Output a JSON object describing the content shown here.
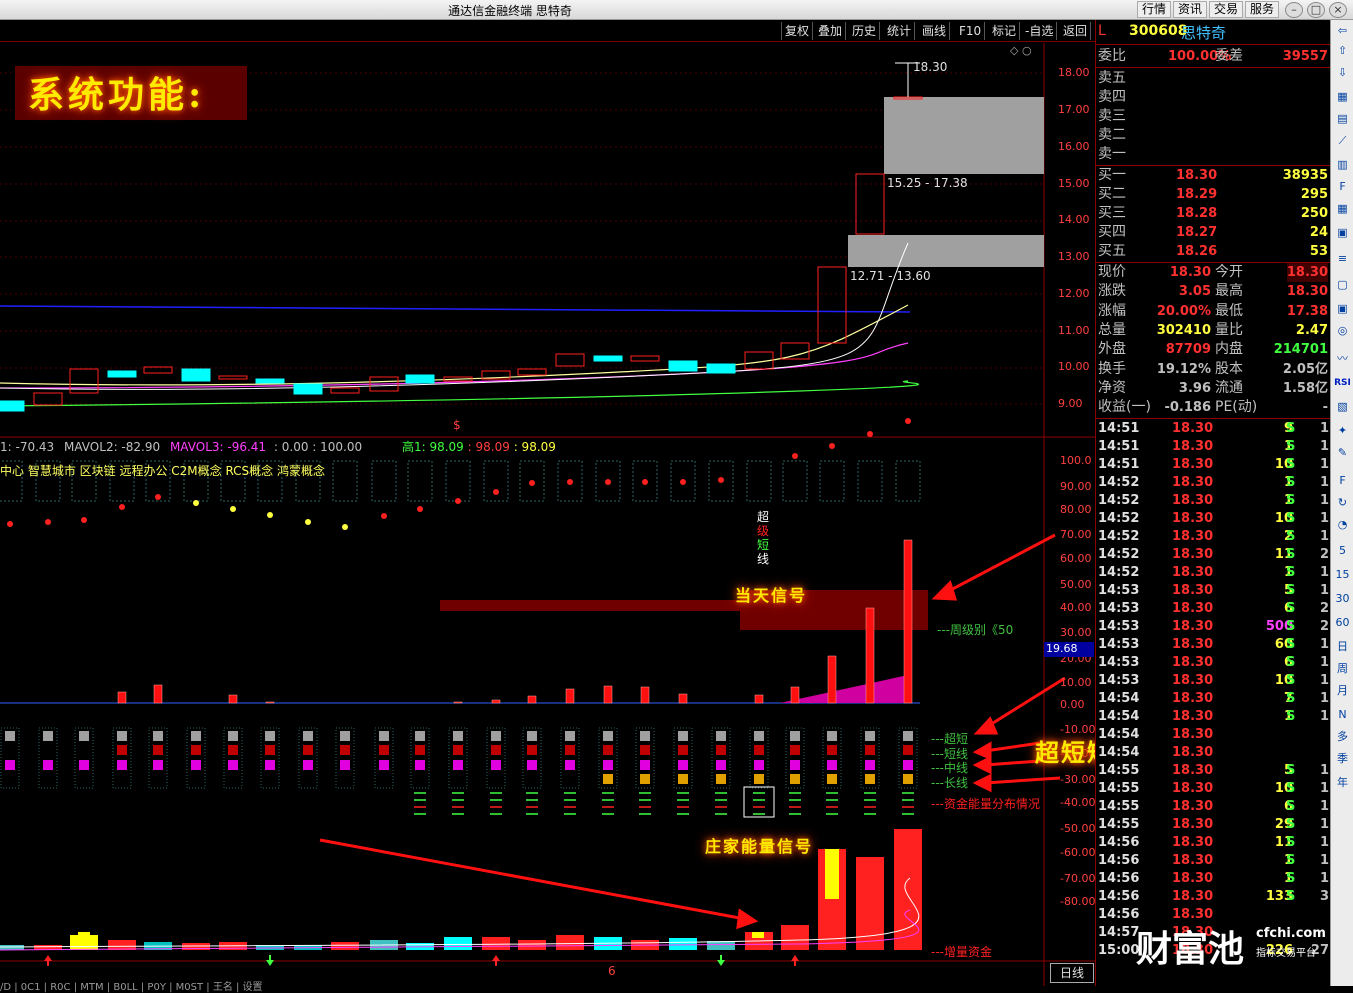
{
  "window": {
    "title": "通达信金融终端  思特奇"
  },
  "top_tabs": [
    "行情",
    "资讯",
    "交易",
    "服务"
  ],
  "toolbar": [
    "复权",
    "叠加",
    "历史",
    "统计",
    "画线",
    "F10",
    "标记",
    "-自选",
    "返回"
  ],
  "stock": {
    "code": "300608",
    "name": "思特奇",
    "marker": "L"
  },
  "price_axis": [
    "18.00",
    "17.00",
    "16.00",
    "15.00",
    "14.00",
    "13.00",
    "12.00",
    "11.00",
    "10.00",
    "9.00"
  ],
  "price_annotations": {
    "high": "18.30",
    "zone_upper": "15.25 - 17.38",
    "zone_lower": "12.71 - 13.60"
  },
  "mavol_line": {
    "v1": "1: -70.43",
    "v2": "MAVOL2: -82.90",
    "v3": "MAVOL3: -96.41",
    "v4": ": 0.00 : 100.00",
    "h_label": "高1: 98.09",
    "h2": ": 98.09",
    "h3": ": 98.09"
  },
  "concepts": "中心 智慧城市 区块链 远程办公 C2M概念 RCS概念 鸿蒙概念",
  "ind_axis": [
    "100.0",
    "90.00",
    "80.00",
    "70.00",
    "60.00",
    "50.00",
    "40.00",
    "30.00",
    "20.00",
    "10.00",
    "0.00",
    "-10.00",
    "-20.00",
    "-30.00",
    "-40.00",
    "-50.00",
    "-60.00",
    "-70.00",
    "-80.00"
  ],
  "ind_current": "19.68",
  "labels": {
    "weekly": "---周级别《50",
    "chaoduan": "---超短",
    "duanxian": "---短线",
    "zhongxian": "---中线",
    "changxian": "---长线",
    "zijin": "---资金能量分布情况",
    "zengliang": "---增量资金",
    "chaoji_1": "超",
    "chaoji_2": "级",
    "chaoji_3": "短",
    "chaoji_4": "线",
    "dollar": "$",
    "day_marker": "6",
    "rixian": "日线"
  },
  "annotations": {
    "system": "系统功能:",
    "today": "当天信号",
    "conditions": "超短短线中线长线条件",
    "zhuangjia": "庄家能量信号"
  },
  "order_book": {
    "weibi_label": "委比",
    "weibi": "100.00%",
    "weicha_label": "委差",
    "weicha": "39557",
    "sells": [
      "卖五",
      "卖四",
      "卖三",
      "卖二",
      "卖一"
    ],
    "buys": [
      {
        "label": "买一",
        "price": "18.30",
        "vol": "38935"
      },
      {
        "label": "买二",
        "price": "18.29",
        "vol": "295"
      },
      {
        "label": "买三",
        "price": "18.28",
        "vol": "250"
      },
      {
        "label": "买四",
        "price": "18.27",
        "vol": "24"
      },
      {
        "label": "买五",
        "price": "18.26",
        "vol": "53"
      }
    ]
  },
  "stats": [
    {
      "l1": "现价",
      "v1": "18.30",
      "l2": "今开",
      "v2": "18.30"
    },
    {
      "l1": "涨跌",
      "v1": "3.05",
      "l2": "最高",
      "v2": "18.30"
    },
    {
      "l1": "涨幅",
      "v1": "20.00%",
      "l2": "最低",
      "v2": "17.38"
    },
    {
      "l1": "总量",
      "v1": "302410",
      "l2": "量比",
      "v2": "2.47"
    },
    {
      "l1": "外盘",
      "v1": "87709",
      "l2": "内盘",
      "v2": "214701"
    },
    {
      "l1": "换手",
      "v1": "19.12%",
      "l2": "股本",
      "v2": "2.05亿"
    },
    {
      "l1": "净资",
      "v1": "3.96",
      "l2": "流通",
      "v2": "1.58亿"
    },
    {
      "l1": "收益(一)",
      "v1": "-0.186",
      "l2": "PE(动)",
      "v2": "-"
    }
  ],
  "ticks": [
    {
      "t": "14:51",
      "p": "18.30",
      "v": "9",
      "s": "S",
      "n": "1"
    },
    {
      "t": "14:51",
      "p": "18.30",
      "v": "1",
      "s": "S",
      "n": "1"
    },
    {
      "t": "14:51",
      "p": "18.30",
      "v": "10",
      "s": "S",
      "n": "1"
    },
    {
      "t": "14:52",
      "p": "18.30",
      "v": "1",
      "s": "S",
      "n": "1"
    },
    {
      "t": "14:52",
      "p": "18.30",
      "v": "1",
      "s": "S",
      "n": "1"
    },
    {
      "t": "14:52",
      "p": "18.30",
      "v": "10",
      "s": "S",
      "n": "1"
    },
    {
      "t": "14:52",
      "p": "18.30",
      "v": "2",
      "s": "S",
      "n": "1"
    },
    {
      "t": "14:52",
      "p": "18.30",
      "v": "11",
      "s": "S",
      "n": "2"
    },
    {
      "t": "14:52",
      "p": "18.30",
      "v": "1",
      "s": "S",
      "n": "1"
    },
    {
      "t": "14:53",
      "p": "18.30",
      "v": "5",
      "s": "S",
      "n": "1"
    },
    {
      "t": "14:53",
      "p": "18.30",
      "v": "6",
      "s": "S",
      "n": "2"
    },
    {
      "t": "14:53",
      "p": "18.30",
      "v": "500",
      "s": "S",
      "n": "2"
    },
    {
      "t": "14:53",
      "p": "18.30",
      "v": "60",
      "s": "S",
      "n": "1"
    },
    {
      "t": "14:53",
      "p": "18.30",
      "v": "6",
      "s": "S",
      "n": "1"
    },
    {
      "t": "14:53",
      "p": "18.30",
      "v": "10",
      "s": "S",
      "n": "1"
    },
    {
      "t": "14:54",
      "p": "18.30",
      "v": "7",
      "s": "S",
      "n": "1"
    },
    {
      "t": "14:54",
      "p": "18.30",
      "v": "1",
      "s": "S",
      "n": "1"
    },
    {
      "t": "14:54",
      "p": "18.30",
      "v": "",
      "s": "",
      "n": ""
    },
    {
      "t": "14:54",
      "p": "18.30",
      "v": "",
      "s": "",
      "n": ""
    },
    {
      "t": "14:55",
      "p": "18.30",
      "v": "5",
      "s": "S",
      "n": "1"
    },
    {
      "t": "14:55",
      "p": "18.30",
      "v": "10",
      "s": "S",
      "n": "1"
    },
    {
      "t": "14:55",
      "p": "18.30",
      "v": "6",
      "s": "S",
      "n": "1"
    },
    {
      "t": "14:55",
      "p": "18.30",
      "v": "29",
      "s": "S",
      "n": "1"
    },
    {
      "t": "14:56",
      "p": "18.30",
      "v": "11",
      "s": "S",
      "n": "1"
    },
    {
      "t": "14:56",
      "p": "18.30",
      "v": "1",
      "s": "S",
      "n": "1"
    },
    {
      "t": "14:56",
      "p": "18.30",
      "v": "1",
      "s": "S",
      "n": "1"
    },
    {
      "t": "14:56",
      "p": "18.30",
      "v": "133",
      "s": "S",
      "n": "3"
    },
    {
      "t": "14:56",
      "p": "18.30",
      "v": "",
      "s": "",
      "n": ""
    },
    {
      "t": "14:57",
      "p": "18.30",
      "v": "",
      "s": "",
      "n": ""
    },
    {
      "t": "15:00",
      "p": "18.30",
      "v": "226",
      "s": "",
      "n": "27"
    }
  ],
  "watermark": {
    "big": "财富池",
    "url": "cfchi.com",
    "sub": "指标交易平台"
  },
  "sidebar_items": [
    "日",
    "周",
    "月",
    "N",
    "多",
    "季",
    "年",
    "5",
    "15",
    "30",
    "60",
    "RSI"
  ],
  "bottom_tabs": "/D | 0C1 | R0C | MTM | B0LL | P0Y | M0ST | 王名 | 设置"
}
